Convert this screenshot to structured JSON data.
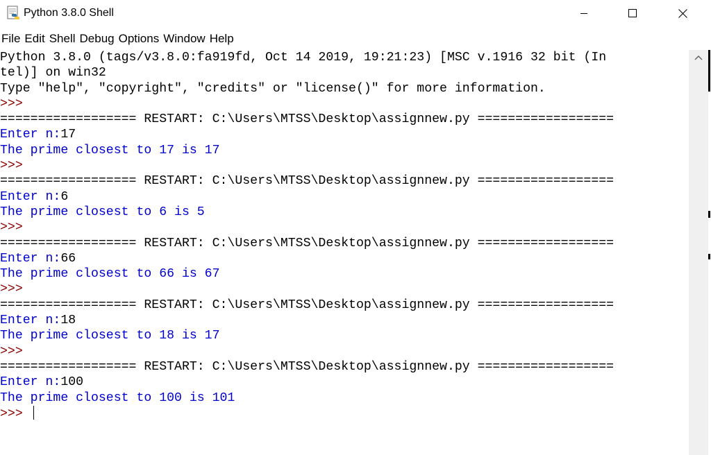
{
  "window": {
    "title": "Python 3.8.0 Shell"
  },
  "menu": [
    "File",
    "Edit",
    "Shell",
    "Debug",
    "Options",
    "Window",
    "Help"
  ],
  "shell": {
    "lines": [
      {
        "text": "Python 3.8.0 (tags/v3.8.0:fa919fd, Oct 14 2019, 19:21:23) [MSC v.1916 32 bit (In",
        "type": "output"
      },
      {
        "text": "tel)] on win32",
        "type": "output"
      },
      {
        "text": "Type \"help\", \"copyright\", \"credits\" or \"license()\" for more information.",
        "type": "output"
      },
      {
        "text": ">>> ",
        "type": "prompt"
      },
      {
        "text": "================== RESTART: C:\\Users\\MTSS\\Desktop\\assignnew.py ==================",
        "type": "restart"
      },
      {
        "text": "Enter n:",
        "type": "stdout",
        "input": "17"
      },
      {
        "text": "The prime closest to 17 is 17",
        "type": "stdout"
      },
      {
        "text": ">>> ",
        "type": "prompt"
      },
      {
        "text": "================== RESTART: C:\\Users\\MTSS\\Desktop\\assignnew.py ==================",
        "type": "restart"
      },
      {
        "text": "Enter n:",
        "type": "stdout",
        "input": "6"
      },
      {
        "text": "The prime closest to 6 is 5",
        "type": "stdout"
      },
      {
        "text": ">>> ",
        "type": "prompt"
      },
      {
        "text": "================== RESTART: C:\\Users\\MTSS\\Desktop\\assignnew.py ==================",
        "type": "restart"
      },
      {
        "text": "Enter n:",
        "type": "stdout",
        "input": "66"
      },
      {
        "text": "The prime closest to 66 is 67",
        "type": "stdout"
      },
      {
        "text": ">>> ",
        "type": "prompt"
      },
      {
        "text": "================== RESTART: C:\\Users\\MTSS\\Desktop\\assignnew.py ==================",
        "type": "restart"
      },
      {
        "text": "Enter n:",
        "type": "stdout",
        "input": "18"
      },
      {
        "text": "The prime closest to 18 is 17",
        "type": "stdout"
      },
      {
        "text": ">>> ",
        "type": "prompt"
      },
      {
        "text": "================== RESTART: C:\\Users\\MTSS\\Desktop\\assignnew.py ==================",
        "type": "restart"
      },
      {
        "text": "Enter n:",
        "type": "stdout",
        "input": "100"
      },
      {
        "text": "The prime closest to 100 is 101",
        "type": "stdout"
      },
      {
        "text": ">>> ",
        "type": "prompt",
        "cursor": true
      }
    ]
  },
  "colors": {
    "prompt": "#8b0000",
    "stdout": "#0000d0",
    "stdin": "#000000",
    "text": "#000000"
  },
  "icons": {
    "app": "python-idle-icon",
    "minimize": "minimize-icon",
    "maximize": "maximize-icon",
    "close": "close-icon",
    "scroll_up": "scroll-up-arrow-icon"
  }
}
